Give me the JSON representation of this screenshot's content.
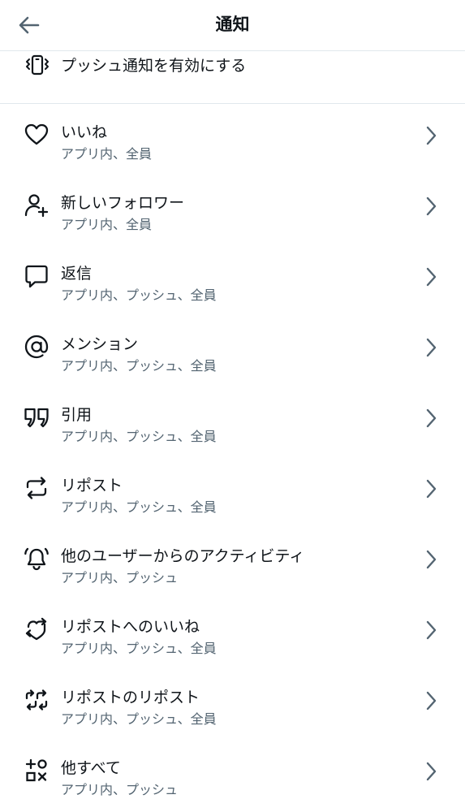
{
  "header": {
    "title": "通知",
    "back_icon": "arrow-left-icon"
  },
  "push": {
    "label": "プッシュ通知を有効にする",
    "icon": "phone-vibrate-icon"
  },
  "items": [
    {
      "title": "いいね",
      "subtitle": "アプリ内、全員",
      "icon": "heart-icon"
    },
    {
      "title": "新しいフォロワー",
      "subtitle": "アプリ内、全員",
      "icon": "person-add-icon"
    },
    {
      "title": "返信",
      "subtitle": "アプリ内、プッシュ、全員",
      "icon": "speech-bubble-icon"
    },
    {
      "title": "メンション",
      "subtitle": "アプリ内、プッシュ、全員",
      "icon": "at-sign-icon"
    },
    {
      "title": "引用",
      "subtitle": "アプリ内、プッシュ、全員",
      "icon": "quote-icon"
    },
    {
      "title": "リポスト",
      "subtitle": "アプリ内、プッシュ、全員",
      "icon": "repost-icon"
    },
    {
      "title": "他のユーザーからのアクティビティ",
      "subtitle": "アプリ内、プッシュ",
      "icon": "bell-ring-icon"
    },
    {
      "title": "リポストへのいいね",
      "subtitle": "アプリ内、プッシュ、全員",
      "icon": "heart-repost-icon"
    },
    {
      "title": "リポストのリポスト",
      "subtitle": "アプリ内、プッシュ、全員",
      "icon": "repost-of-repost-icon"
    },
    {
      "title": "他すべて",
      "subtitle": "アプリ内、プッシュ",
      "icon": "grid-plus-icon"
    }
  ],
  "colors": {
    "text": "#0f1419",
    "subtext": "#536471",
    "divider": "#e1e8ed"
  }
}
